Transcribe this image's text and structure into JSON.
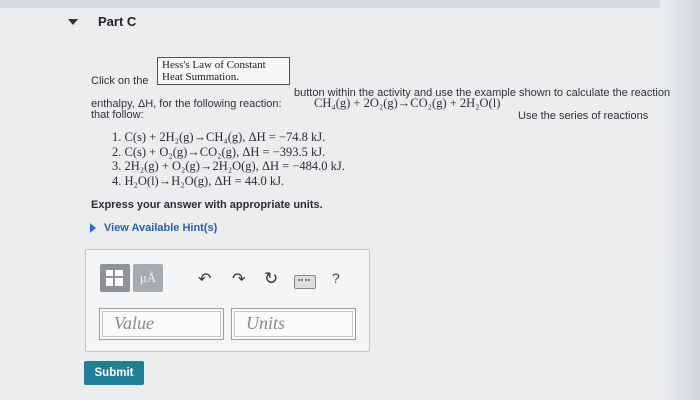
{
  "part": {
    "title": "Part C"
  },
  "activity_button": {
    "line1": "Hess's Law of Constant",
    "line2": "Heat Summation."
  },
  "instructions": {
    "click_on": "Click on the",
    "after_button": "button within the activity and use the example shown to calculate the reaction",
    "line2_start": "enthalpy, ΔH, for the following reaction:",
    "reaction": "CH₄(g) + 2O₂(g)→CO₂(g) + 2H₂O(l)",
    "line2_end": "Use the series of reactions",
    "line3": "that follow:"
  },
  "reactions": [
    "1.  C(s) + 2H₂(g)→CH₄(g), ΔH = −74.8 kJ.",
    "2.  C(s) + O₂(g)→CO₂(g), ΔH = −393.5 kJ.",
    "3.  2H₂(g) + O₂(g)→2H₂O(g), ΔH = −484.0 kJ.",
    "4.  H₂O(l)→H₂O(g), ΔH = 44.0 kJ."
  ],
  "express": "Express your answer with appropriate units.",
  "hint": "View Available Hint(s)",
  "toolbar": {
    "mu_label": "μÅ",
    "undo_glyph": "↶",
    "redo_glyph": "↷",
    "reset_glyph": "↻",
    "help_glyph": "?",
    "icons": [
      "templates-icon",
      "units-icon",
      "undo-icon",
      "redo-icon",
      "reset-icon",
      "keyboard-icon",
      "help-icon"
    ]
  },
  "fields": {
    "value_placeholder": "Value",
    "units_placeholder": "Units"
  },
  "submit_label": "Submit",
  "colors": {
    "submit": "#1f7f96",
    "link": "#2b5fa8",
    "toolbar_button": "#8f9296"
  }
}
